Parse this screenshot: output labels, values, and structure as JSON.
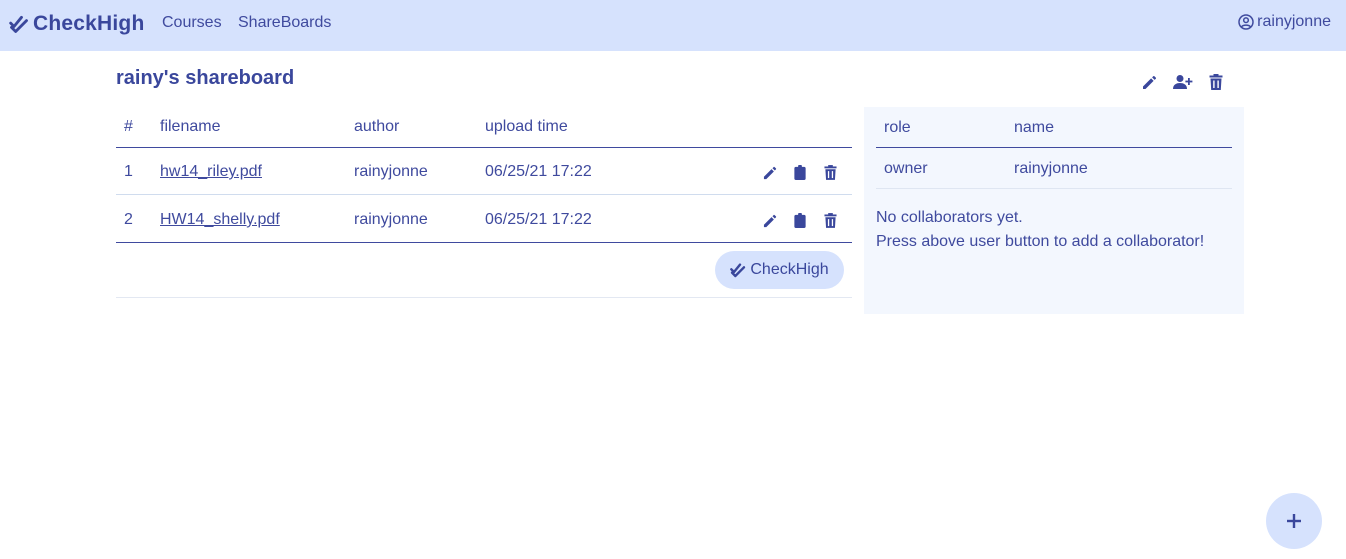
{
  "navbar": {
    "brand_icon": "double-check-icon",
    "brand": "CheckHigh",
    "links": [
      "Courses",
      "ShareBoards"
    ],
    "user_icon": "user-circle-icon",
    "username": "rainyjonne"
  },
  "board": {
    "title": "rainy's shareboard",
    "actions": [
      "pencil-icon",
      "user-plus-icon",
      "trash-icon"
    ]
  },
  "files": {
    "headers": [
      "#",
      "filename",
      "author",
      "upload time"
    ],
    "rows": [
      {
        "num": "1",
        "filename": "hw14_riley.pdf",
        "author": "rainyjonne",
        "upload_time": "06/25/21 17:22",
        "actions": [
          "pencil-icon",
          "clipboard-icon",
          "trash-icon"
        ]
      },
      {
        "num": "2",
        "filename": "HW14_shelly.pdf",
        "author": "rainyjonne",
        "upload_time": "06/25/21 17:22",
        "actions": [
          "pencil-icon",
          "clipboard-icon",
          "trash-icon"
        ]
      }
    ],
    "checkhigh_button": "CheckHigh"
  },
  "collaborators": {
    "headers": [
      "role",
      "name"
    ],
    "rows": [
      {
        "role": "owner",
        "name": "rainyjonne"
      }
    ],
    "empty_line1": "No collaborators yet.",
    "empty_line2": "Press above user button to add a collaborator!"
  },
  "fab": {
    "icon": "plus-icon"
  },
  "colors": {
    "navbar_bg": "#d6e2fd",
    "accent": "#3a479c",
    "panel_bg": "#f3f7fe"
  }
}
